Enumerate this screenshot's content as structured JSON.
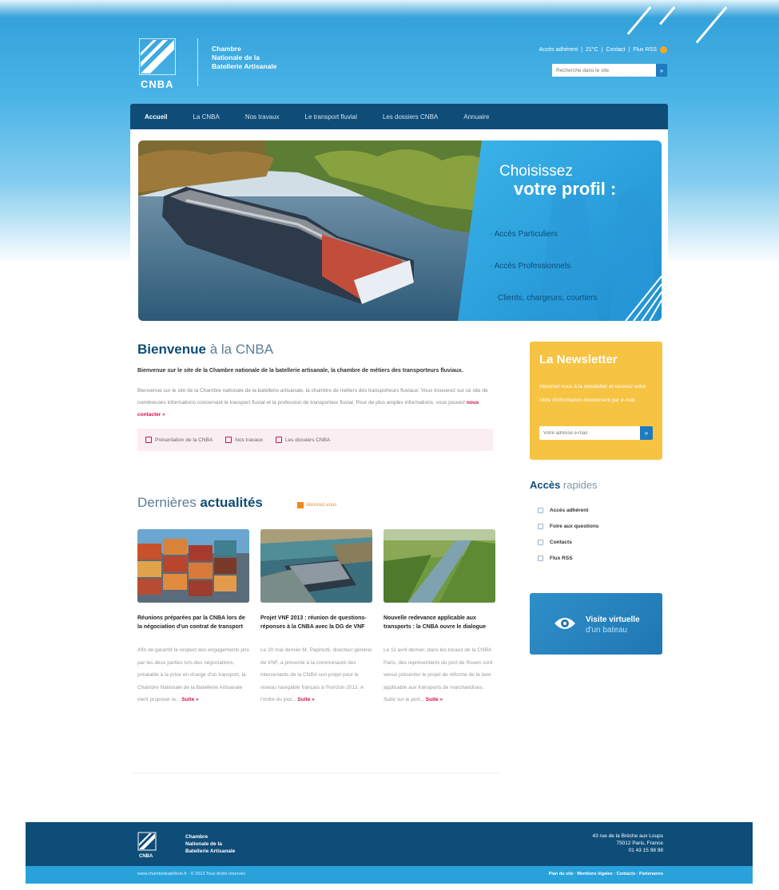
{
  "brand": {
    "logo_text": "CNBA",
    "org_name_line1": "Chambre",
    "org_name_line2": "Nationale de la",
    "org_name_line3": "Batellerie Artisanale"
  },
  "top_links": {
    "member_access": "Accès adhérent",
    "weather": "21°C",
    "contact": "Contact",
    "rss": "Flux RSS",
    "sep": "|"
  },
  "search": {
    "placeholder": "Recherche dans le site",
    "button": "»"
  },
  "nav": {
    "items": [
      {
        "label": "Accueil"
      },
      {
        "label": "La CNBA"
      },
      {
        "label": "Nos travaux"
      },
      {
        "label": "Le transport fluvial"
      },
      {
        "label": "Les dossiers CNBA"
      },
      {
        "label": "Annuaire"
      }
    ]
  },
  "hero": {
    "title_line1": "Choisissez",
    "title_line2": "votre profil :",
    "links": [
      {
        "label": "Accès Particuliers"
      },
      {
        "label": "Accès Professionnels"
      },
      {
        "label": "Clients, chargeurs, courtiers"
      }
    ]
  },
  "welcome": {
    "title_bold": "Bienvenue",
    "title_rest": " à la CNBA",
    "lead": "Bienvenue sur le site de la Chambre nationale de la batellerie artisanale, la chambre de métiers des transporteurs fluviaux.",
    "body": "Bienvenue sur le site de la Chambre nationale de la batellerie artisanale, la chambre de métiers des transporteurs fluviaux. Vous trouverez sur ce site de nombreuses informations concernant le transport fluvial et la profession de transporteur fluvial. Pour de plus amples informations, vous pouvez",
    "more": "nous contacter »",
    "tabs": [
      {
        "label": "Présentation de la CNBA"
      },
      {
        "label": "Nos travaux"
      },
      {
        "label": "Les dossiers CNBA"
      }
    ]
  },
  "news": {
    "title_light": "Dernières ",
    "title_bold": "actualités",
    "rss": "Abonnez-vous",
    "items": [
      {
        "title": "Réunions préparées par la CNBA lors de la négociation d'un contrat de transport",
        "body": "Afin de garantir le respect des engagements pris par les deux parties lors des négociations, préalable à la prise en charge d'un transport, la Chambre Nationale de la Batellerie Artisanale vient proposer le...",
        "more": "Suite »"
      },
      {
        "title": "Projet VNF 2013 : réunion de questions-réponses à la CNBA avec la DG de VNF",
        "body": "Le 20 mai dernier M. Papinutti, directeur général de VNF, a présenté à la communauté des intervenants de la CNBA son projet pour le réseau navigable français à l'horizon 2013. A l'ordre du jour...",
        "more": "Suite »"
      },
      {
        "title": "Nouvelle redevance applicable aux transports : la CNBA ouvre le dialogue",
        "body": "Le 11 avril dernier, dans les locaux de la CNBA Paris, des représentants du port de Rouen sont venus présenter le projet de réforme de la taxe applicable aux transports de marchandises. Suite sur le port...",
        "more": "Suite »"
      }
    ]
  },
  "newsletter": {
    "title": "La Newsletter",
    "text": "Abonnez-vous à la newsletter et recevez votre lettre d'information directement par e-mail.",
    "placeholder": "Votre adresse e-mail",
    "button": "»"
  },
  "quick_access": {
    "title_bold": "Accès",
    "title_light": " rapides",
    "items": [
      {
        "label": "Accès adhérent"
      },
      {
        "label": "Foire aux questions"
      },
      {
        "label": "Contacts"
      },
      {
        "label": "Flux RSS"
      }
    ]
  },
  "visit": {
    "line1": "Visite virtuelle",
    "line2": "d'un bateau"
  },
  "footer": {
    "logo_text": "CNBA",
    "org_line1": "Chambre",
    "org_line2": "Nationale de la",
    "org_line3": "Batellerie Artisanale",
    "addr_line1": "43 rue de la Bréche aux Loups",
    "addr_line2": "75012 Paris, France",
    "addr_line3": "01 43 15 98 98",
    "copyright": "www.chambrebatellerie.fr - © 2013 Tous droits réservés",
    "links": "Plan du site · Mentions légales · Contacts · Partenaires"
  },
  "colors": {
    "navy": "#0e4d78",
    "sky": "#29a2db",
    "accent": "#d0104a",
    "yellow": "#f6c343",
    "orange": "#f08a1c"
  }
}
